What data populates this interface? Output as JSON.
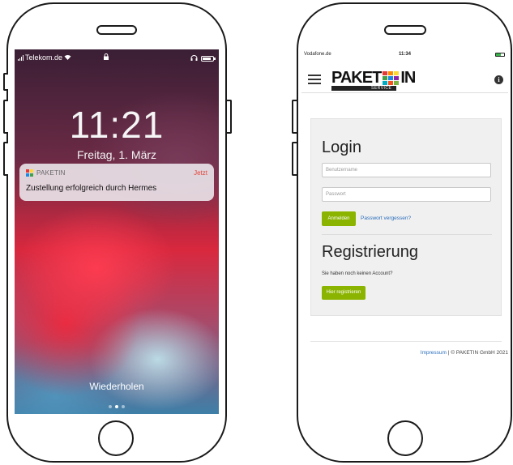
{
  "left_phone": {
    "status": {
      "carrier": "Telekom.de",
      "wifi_icon": "wifi-icon",
      "lock_icon": "lock-icon",
      "headphones_icon": "headphones-icon",
      "battery_icon": "battery-icon"
    },
    "clock": "11:21",
    "date": "Freitag, 1. März",
    "notification": {
      "app": "PAKETIN",
      "time": "Jetzt",
      "message": "Zustellung erfolgreich durch Hermes"
    },
    "repeat_label": "Wiederholen",
    "page_dots": 3,
    "active_dot": 1
  },
  "right_phone": {
    "status": {
      "carrier": "Vodafone.de",
      "time": "11:34"
    },
    "header": {
      "logo_left": "PAKET",
      "logo_right": "IN",
      "logo_sub": "SERVICE",
      "menu_icon": "hamburger-menu-icon",
      "info_icon": "info-icon"
    },
    "login": {
      "title": "Login",
      "username_placeholder": "Benutzername",
      "password_placeholder": "Passwort",
      "submit": "Anmelden",
      "forgot": "Passwort vergessen?"
    },
    "register": {
      "title": "Registrierung",
      "hint": "Sie haben noch keinen Account?",
      "button": "Hier registrieren"
    },
    "footer": {
      "link": "Impressum",
      "text": " | © PAKETIN GmbH 2021"
    }
  },
  "colors": {
    "accent_green": "#8bb400",
    "link_blue": "#2a6ebd",
    "notification_time": "#e0453a",
    "logo_squares": [
      "#e53935",
      "#fb8c00",
      "#fdd835",
      "#43a047",
      "#1e88e5",
      "#8e24aa",
      "#00acc1",
      "#f4511e",
      "#7cb342"
    ]
  }
}
